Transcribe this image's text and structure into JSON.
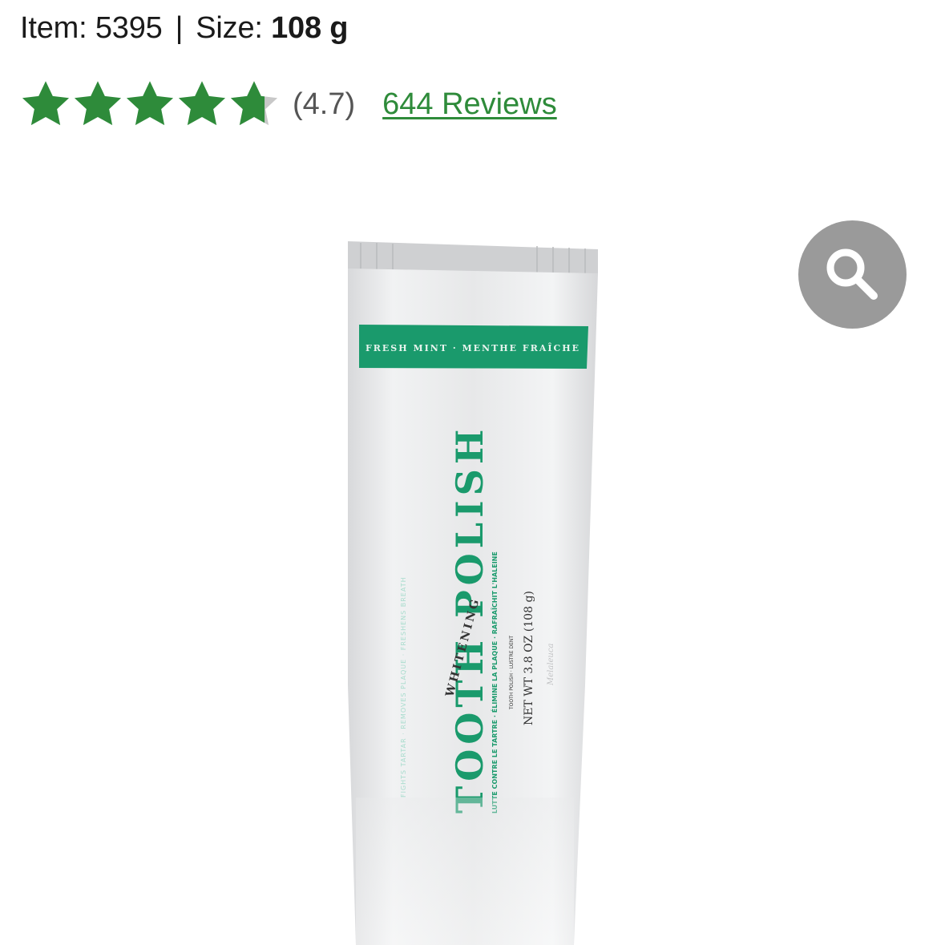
{
  "product": {
    "item_label": "Item:",
    "item_number": "5395",
    "separator": "|",
    "size_label": "Size:",
    "size_value": "108 g"
  },
  "rating": {
    "value": 4.7,
    "max": 5,
    "display": "(4.7)",
    "reviews_link": "644 Reviews",
    "star_color": "#2e8b3a"
  },
  "zoom": {
    "icon": "magnifier-icon",
    "color": "#9a9a9a"
  },
  "image": {
    "band_text": "FRESH MINT · MENTHE FRAÎCHE",
    "title": "TOOTH POLISH",
    "whitening": "WHITENING",
    "side_text": "FIGHTS TARTAR · REMOVES PLAQUE · FRESHENS BREATH",
    "sub_text": "LUTTE CONTRE LE TARTRE · ÉLIMINE LA PLAQUE · RAFRAÎCHIT L'HALEINE",
    "small_text": "TOOTH POLISH · LUSTRE DENT",
    "net_wt": "NET WT 3.8 OZ (108 g)",
    "brand": "Melaleuca",
    "accent": "#1a9a6c"
  }
}
